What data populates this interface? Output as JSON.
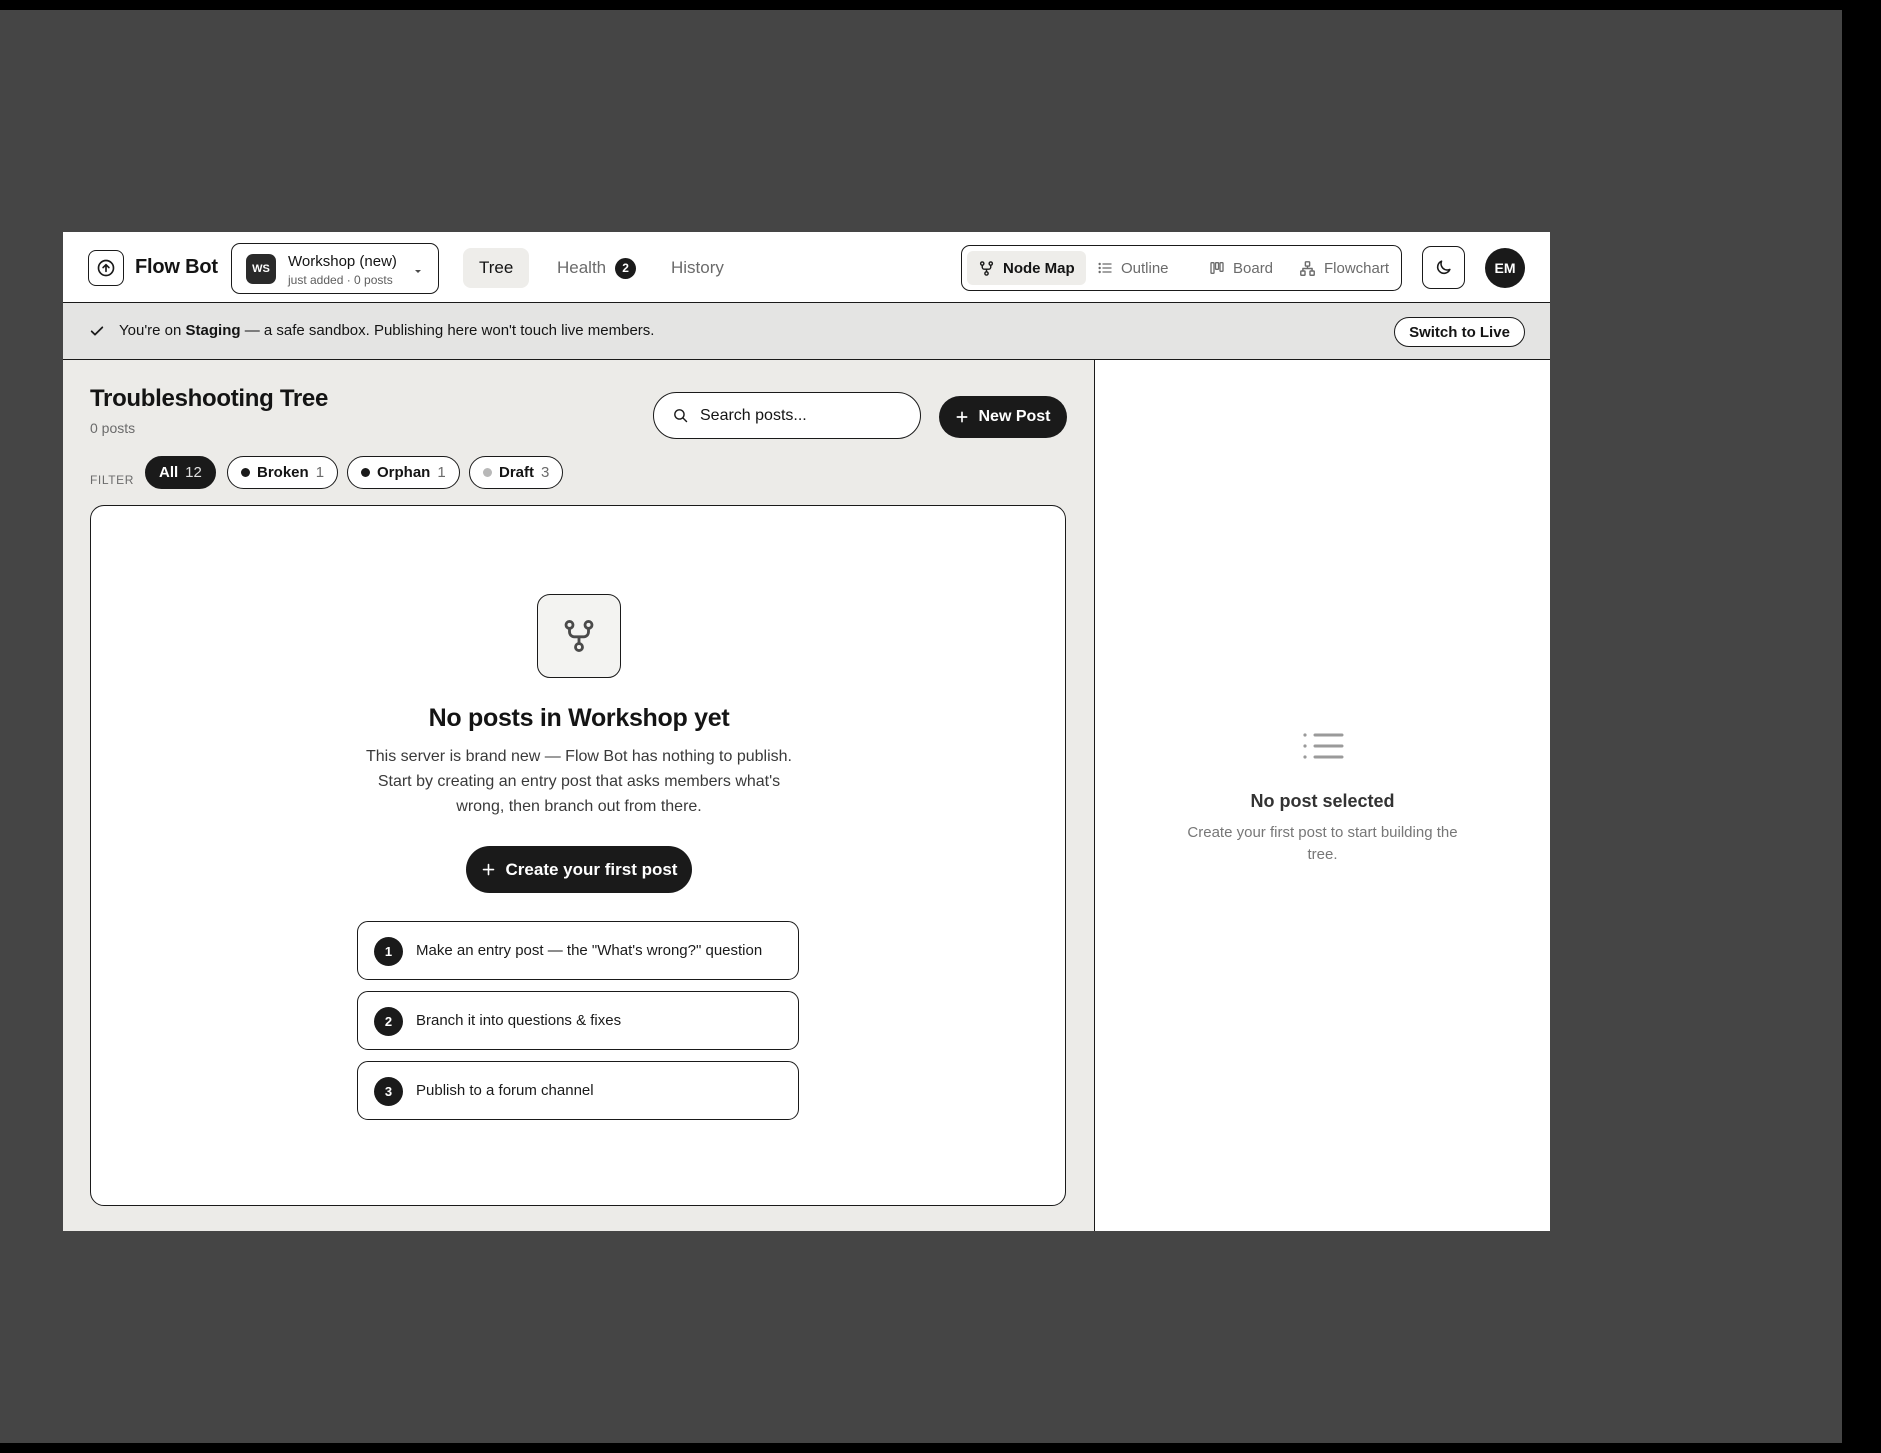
{
  "app": {
    "name": "Flow Bot"
  },
  "workspace": {
    "initials": "WS",
    "name": "Workshop (new)",
    "meta": "just added · 0 posts"
  },
  "nav": {
    "tabs": [
      {
        "label": "Tree",
        "active": true
      },
      {
        "label": "Health",
        "badge": "2"
      },
      {
        "label": "History"
      }
    ]
  },
  "views": [
    {
      "label": "Node Map",
      "icon": "node-map-icon",
      "active": true
    },
    {
      "label": "Outline",
      "icon": "outline-icon"
    },
    {
      "label": "Board",
      "icon": "board-icon"
    },
    {
      "label": "Flowchart",
      "icon": "flowchart-icon"
    }
  ],
  "user": {
    "initials": "EM"
  },
  "banner": {
    "prefix": "You're on ",
    "env": "Staging",
    "suffix": " — a safe sandbox. Publishing here won't touch live members.",
    "button": "Switch to Live"
  },
  "main": {
    "title": "Troubleshooting Tree",
    "subtitle": "0 posts",
    "search_placeholder": "Search posts...",
    "new_post_label": "New Post",
    "filter_label": "FILTER",
    "filters": [
      {
        "label": "All",
        "count": "12",
        "active": true
      },
      {
        "label": "Broken",
        "count": "1"
      },
      {
        "label": "Orphan",
        "count": "1"
      },
      {
        "label": "Draft",
        "count": "3"
      }
    ],
    "empty": {
      "title": "No posts in Workshop yet",
      "description": "This server is brand new — Flow Bot has nothing to publish. Start by creating an entry post that asks members what's wrong, then branch out from there.",
      "button": "Create your first post",
      "steps": [
        {
          "num": "1",
          "text": "Make an entry post — the \"What's wrong?\" question"
        },
        {
          "num": "2",
          "text": "Branch it into questions & fixes"
        },
        {
          "num": "3",
          "text": "Publish to a forum channel"
        }
      ]
    }
  },
  "side": {
    "title": "No post selected",
    "description": "Create your first post to start building the tree."
  },
  "colors": {
    "ink": "#1a1a1a",
    "canvas": "#ecebe8",
    "banner": "#e4e4e3",
    "desktop": "#454545"
  }
}
